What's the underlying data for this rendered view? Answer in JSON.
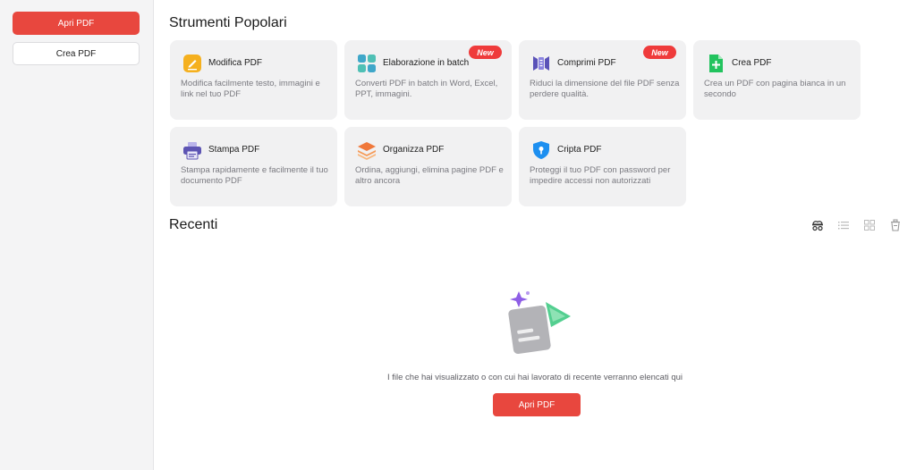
{
  "sidebar": {
    "open_label": "Apri PDF",
    "create_label": "Crea PDF"
  },
  "popular": {
    "title": "Strumenti Popolari",
    "tools": [
      {
        "name": "Modifica PDF",
        "desc": "Modifica facilmente testo, immagini e link nel tuo PDF",
        "icon": "edit-icon",
        "badge": ""
      },
      {
        "name": "Elaborazione in batch",
        "desc": "Converti PDF in batch in Word, Excel, PPT, immagini.",
        "icon": "batch-icon",
        "badge": "New"
      },
      {
        "name": "Comprimi PDF",
        "desc": "Riduci la dimensione del file PDF senza perdere qualità.",
        "icon": "compress-icon",
        "badge": "New"
      },
      {
        "name": "Crea PDF",
        "desc": "Crea un PDF con pagina bianca in un secondo",
        "icon": "create-icon",
        "badge": ""
      },
      {
        "name": "Stampa PDF",
        "desc": "Stampa rapidamente e facilmente il tuo documento PDF",
        "icon": "print-icon",
        "badge": ""
      },
      {
        "name": "Organizza PDF",
        "desc": "Ordina, aggiungi, elimina pagine PDF e altro ancora",
        "icon": "organize-icon",
        "badge": ""
      },
      {
        "name": "Cripta PDF",
        "desc": "Proteggi il tuo PDF con password per impedire accessi non autorizzati",
        "icon": "shield-icon",
        "badge": ""
      }
    ]
  },
  "recent": {
    "title": "Recenti",
    "view_icons": [
      "cloud-icon",
      "list-view-icon",
      "grid-view-icon",
      "trash-icon"
    ],
    "empty_message": "I file che hai visualizzato o con cui hai lavorato di recente verranno elencati qui",
    "open_label": "Apri PDF"
  },
  "colors": {
    "accent": "#e8473e",
    "badge": "#ef3b3b"
  }
}
